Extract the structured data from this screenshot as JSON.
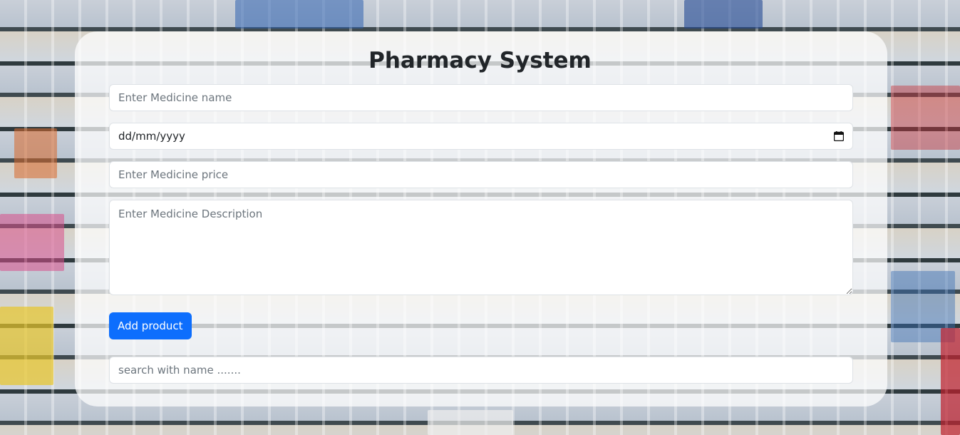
{
  "page": {
    "title": "Pharmacy System"
  },
  "form": {
    "medicine_name": {
      "placeholder": "Enter Medicine name",
      "value": ""
    },
    "expiry_date": {
      "placeholder": "dd/mm/yyyy",
      "icon": "calendar-icon"
    },
    "medicine_price": {
      "placeholder": "Enter Medicine price",
      "value": ""
    },
    "medicine_description": {
      "placeholder": "Enter Medicine Description",
      "value": ""
    },
    "add_button_label": "Add product"
  },
  "search": {
    "placeholder": "search with name .......",
    "value": ""
  },
  "colors": {
    "primary": "#0d6efd",
    "text": "#212529",
    "placeholder": "#6c757d",
    "border": "#dee2e6"
  }
}
